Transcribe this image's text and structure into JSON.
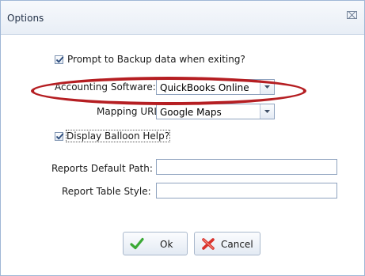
{
  "window": {
    "title": "Options",
    "close_glyph": "⌧"
  },
  "options": {
    "prompt_backup": {
      "label": "Prompt to Backup data when exiting?",
      "checked": true
    },
    "accounting_software": {
      "label": "Accounting Software:",
      "value": "QuickBooks Online"
    },
    "mapping_url": {
      "label": "Mapping URL:",
      "value": "Google Maps"
    },
    "balloon_help": {
      "label": "Display Balloon Help?",
      "checked": true
    },
    "reports_default_path": {
      "label": "Reports Default Path:",
      "value": ""
    },
    "report_table_style": {
      "label": "Report Table Style:",
      "value": ""
    }
  },
  "buttons": {
    "ok_label": "Ok",
    "cancel_label": "Cancel"
  },
  "icons": {
    "ok": "checkmark-icon",
    "cancel": "x-icon"
  },
  "colors": {
    "highlight_oval": "#b51e22",
    "ok_check": "#3aa935",
    "cancel_x": "#d9312b"
  }
}
